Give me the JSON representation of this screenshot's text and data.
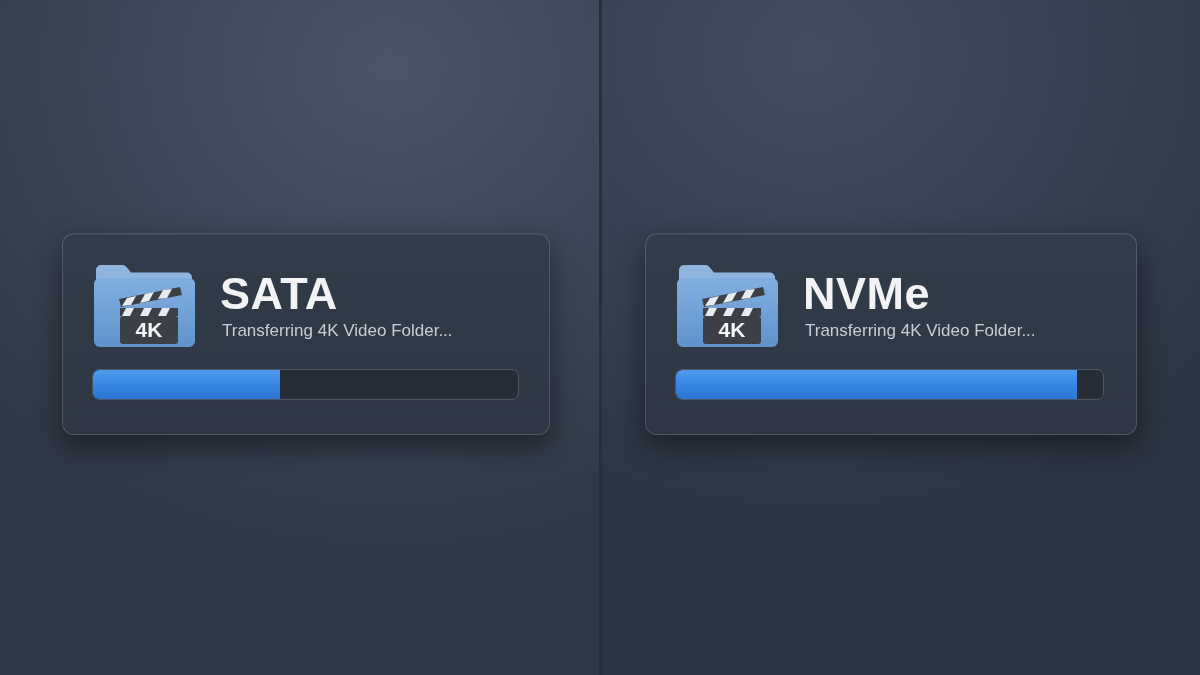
{
  "panels": [
    {
      "title": "SATA",
      "icon_label": "4K",
      "status": "Transferring 4K Video Folder...",
      "progress": {
        "level": 0.44
      }
    },
    {
      "title": "NVMe",
      "icon_label": "4K",
      "status": "Transferring 4K Video Folder...",
      "progress": {
        "level": 0.94
      }
    }
  ]
}
